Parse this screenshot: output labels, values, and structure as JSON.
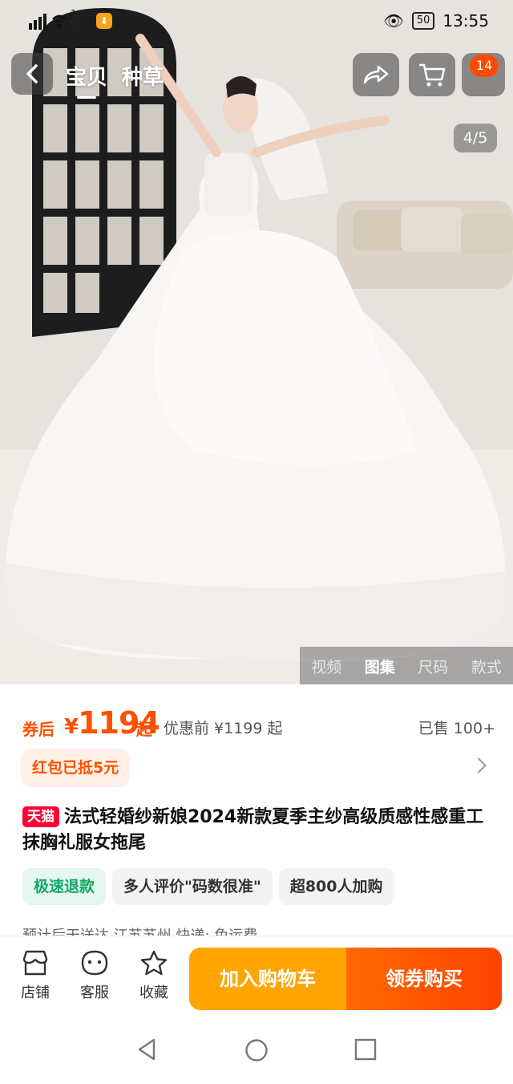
{
  "status_bar": {
    "signal": "4G",
    "speed_value": "1.3",
    "speed_unit": "K/s",
    "battery": "50",
    "time": "13:55"
  },
  "nav": {
    "tabs": [
      {
        "label": "宝贝",
        "active": true
      },
      {
        "label": "种草",
        "active": false
      }
    ],
    "cart_badge": "14"
  },
  "gallery": {
    "counter": "4/5",
    "media_tabs": [
      {
        "label": "视频"
      },
      {
        "label": "图集",
        "active": true
      },
      {
        "label": "尺码"
      },
      {
        "label": "款式"
      }
    ]
  },
  "price": {
    "prefix": "券后",
    "currency": "¥",
    "amount": "1194",
    "suffix": "起",
    "before_label": "优惠前 ¥1199 起",
    "sold": "已售 100+"
  },
  "coupon": {
    "label": "红包已抵5元"
  },
  "product": {
    "store_badge": "天猫",
    "title": "法式轻婚纱新娘2024新款夏季主纱高级质感性感重工抹胸礼服女拖尾"
  },
  "tags": [
    {
      "label": "极速退款",
      "color": "#12a866"
    },
    {
      "label": "多人评价\"码数很准\""
    },
    {
      "label": "超800人加购"
    }
  ],
  "shipping_cut": "预计后天送达 江苏苏州 快递: 免运费",
  "bottom_bar": {
    "shop": "店铺",
    "service": "客服",
    "favorite": "收藏",
    "add_to_cart": "加入购物车",
    "buy_with_coupon": "领券购买"
  },
  "colors": {
    "accent": "#ff5000",
    "tmall": "#ff0036",
    "cart": "#ffa400"
  }
}
